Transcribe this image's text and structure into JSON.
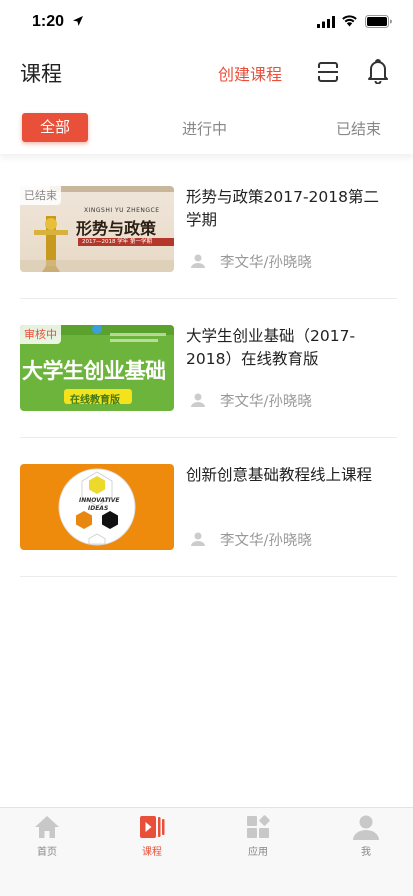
{
  "status_bar": {
    "time": "1:20"
  },
  "header": {
    "title": "课程",
    "create_label": "创建课程"
  },
  "tabs": [
    {
      "label": "全部",
      "active": true
    },
    {
      "label": "进行中",
      "active": false
    },
    {
      "label": "已结束",
      "active": false
    }
  ],
  "courses": [
    {
      "title": "形势与政策2017-2018第二学期",
      "teachers": "李文华/孙晓晓",
      "badge": "已结束",
      "badge_color": "#888888",
      "cover_text": {
        "pinyin": "XINGSHI YU ZHENGCE",
        "title": "形势与政策",
        "band": "2017—2018 学年 第一学期"
      }
    },
    {
      "title": "大学生创业基础（2017-2018）在线教育版",
      "teachers": "李文华/孙晓晓",
      "badge": "审核中",
      "badge_color": "#e8503a",
      "cover_text": {
        "title": "大学生创业基础",
        "band": "在线教育版"
      }
    },
    {
      "title": "创新创意基础教程线上课程",
      "teachers": "李文华/孙晓晓",
      "badge": "",
      "badge_color": "",
      "cover_text": {
        "line1": "INNOVATIVE",
        "line2": "IDEAS"
      }
    }
  ],
  "tab_bar": [
    {
      "label": "首页",
      "icon": "home-icon",
      "active": false
    },
    {
      "label": "课程",
      "icon": "course-icon",
      "active": true
    },
    {
      "label": "应用",
      "icon": "apps-icon",
      "active": false
    },
    {
      "label": "我",
      "icon": "profile-icon",
      "active": false
    }
  ],
  "colors": {
    "accent": "#e8503a",
    "muted": "#999999"
  }
}
